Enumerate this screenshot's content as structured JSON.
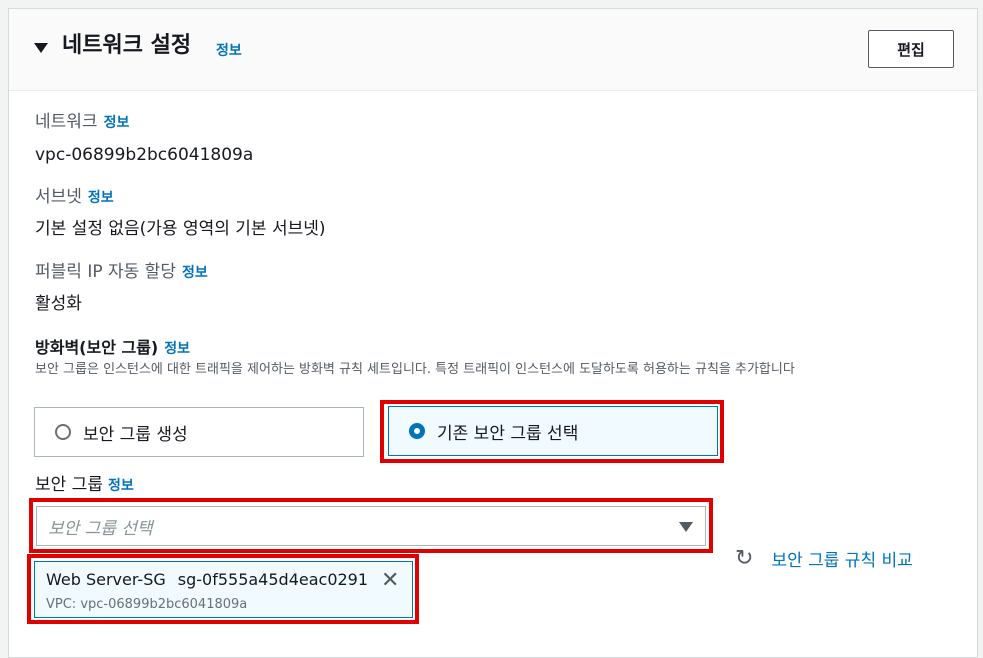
{
  "header": {
    "title": "네트워크 설정",
    "info": "정보",
    "edit_button": "편집"
  },
  "network": {
    "label": "네트워크",
    "info": "정보",
    "value": "vpc-06899b2bc6041809a"
  },
  "subnet": {
    "label": "서브넷",
    "info": "정보",
    "value": "기본 설정 없음(가용 영역의 기본 서브넷)"
  },
  "public_ip": {
    "label": "퍼블릭 IP 자동 할당",
    "info": "정보",
    "value": "활성화"
  },
  "firewall": {
    "title": "방화벽(보안 그룹)",
    "info": "정보",
    "description": "보안 그룹은 인스턴스에 대한 트래픽을 제어하는 방화벽 규칙 세트입니다. 특정 트래픽이 인스턴스에 도달하도록 허용하는 규칙을 추가합니다",
    "options": [
      {
        "label": "보안 그룹 생성",
        "selected": false
      },
      {
        "label": "기존 보안 그룹 선택",
        "selected": true
      }
    ]
  },
  "security_group": {
    "label": "보안 그룹",
    "info": "정보",
    "placeholder": "보안 그룹 선택",
    "selected_token": {
      "name": "Web Server-SG",
      "id": "sg-0f555a45d4eac0291",
      "vpc": "VPC: vpc-06899b2bc6041809a"
    },
    "compare_link": "보안 그룹 규칙 비교"
  },
  "colors": {
    "accent": "#0073bb",
    "highlight": "#e00000"
  },
  "icons": {
    "header_toggle": "caret-down-icon",
    "dropdown": "caret-down-icon",
    "remove": "close-icon",
    "refresh": "refresh-icon"
  }
}
